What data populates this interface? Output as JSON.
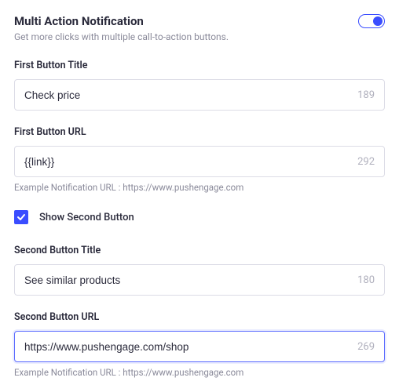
{
  "header": {
    "title": "Multi Action Notification",
    "description": "Get more clicks with multiple call-to-action buttons.",
    "toggle_on": true
  },
  "first_button": {
    "title_label": "First Button Title",
    "title_value": "Check price",
    "title_counter": "189",
    "url_label": "First Button URL",
    "url_value": "{{link}}",
    "url_counter": "292",
    "url_helper": "Example Notification URL : https://www.pushengage.com"
  },
  "show_second": {
    "checked": true,
    "label": "Show Second Button"
  },
  "second_button": {
    "title_label": "Second Button Title",
    "title_value": "See similar products",
    "title_counter": "180",
    "url_label": "Second Button URL",
    "url_value": "https://www.pushengage.com/shop",
    "url_counter": "269",
    "url_helper": "Example Notification URL : https://www.pushengage.com"
  }
}
